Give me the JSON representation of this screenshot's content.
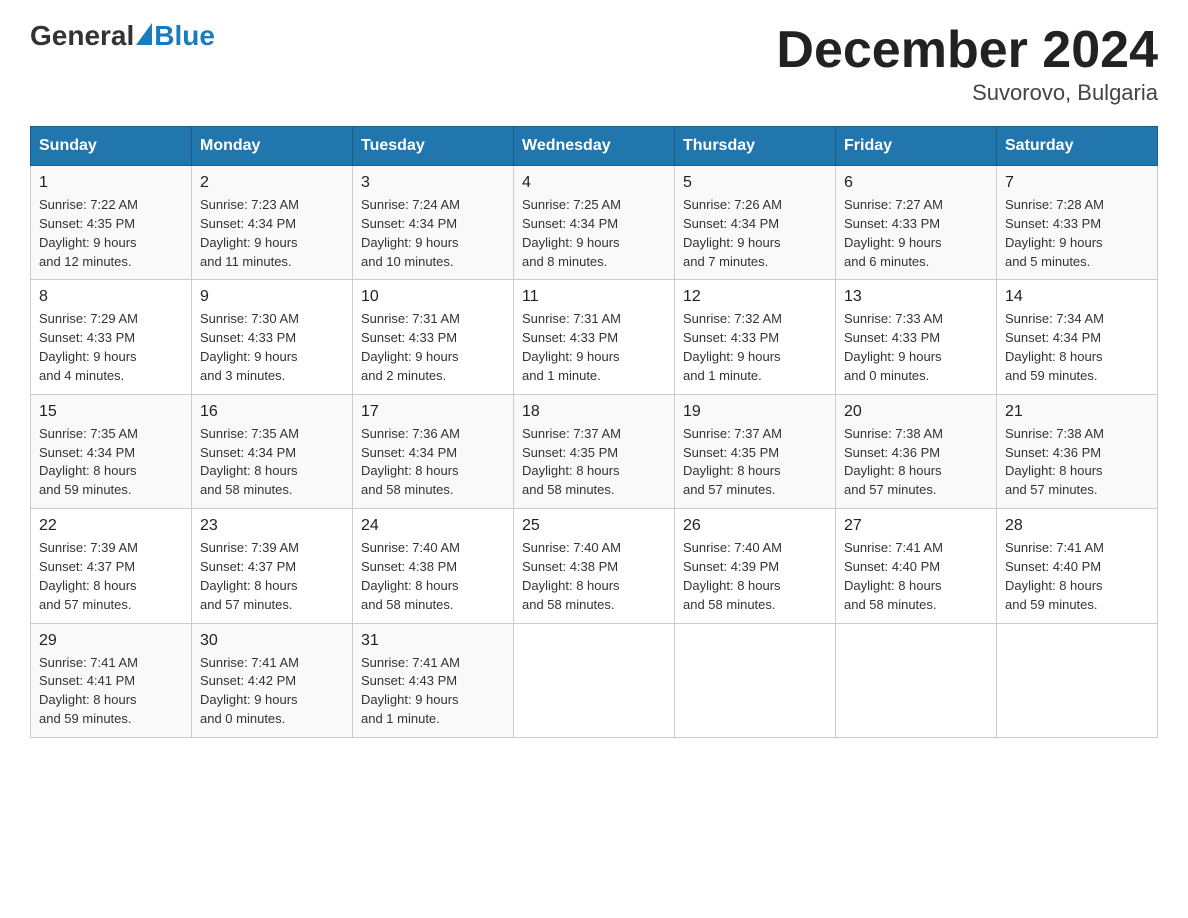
{
  "logo": {
    "general": "General",
    "blue": "Blue"
  },
  "title": "December 2024",
  "subtitle": "Suvorovo, Bulgaria",
  "days_of_week": [
    "Sunday",
    "Monday",
    "Tuesday",
    "Wednesday",
    "Thursday",
    "Friday",
    "Saturday"
  ],
  "weeks": [
    [
      {
        "day": "1",
        "info": "Sunrise: 7:22 AM\nSunset: 4:35 PM\nDaylight: 9 hours\nand 12 minutes."
      },
      {
        "day": "2",
        "info": "Sunrise: 7:23 AM\nSunset: 4:34 PM\nDaylight: 9 hours\nand 11 minutes."
      },
      {
        "day": "3",
        "info": "Sunrise: 7:24 AM\nSunset: 4:34 PM\nDaylight: 9 hours\nand 10 minutes."
      },
      {
        "day": "4",
        "info": "Sunrise: 7:25 AM\nSunset: 4:34 PM\nDaylight: 9 hours\nand 8 minutes."
      },
      {
        "day": "5",
        "info": "Sunrise: 7:26 AM\nSunset: 4:34 PM\nDaylight: 9 hours\nand 7 minutes."
      },
      {
        "day": "6",
        "info": "Sunrise: 7:27 AM\nSunset: 4:33 PM\nDaylight: 9 hours\nand 6 minutes."
      },
      {
        "day": "7",
        "info": "Sunrise: 7:28 AM\nSunset: 4:33 PM\nDaylight: 9 hours\nand 5 minutes."
      }
    ],
    [
      {
        "day": "8",
        "info": "Sunrise: 7:29 AM\nSunset: 4:33 PM\nDaylight: 9 hours\nand 4 minutes."
      },
      {
        "day": "9",
        "info": "Sunrise: 7:30 AM\nSunset: 4:33 PM\nDaylight: 9 hours\nand 3 minutes."
      },
      {
        "day": "10",
        "info": "Sunrise: 7:31 AM\nSunset: 4:33 PM\nDaylight: 9 hours\nand 2 minutes."
      },
      {
        "day": "11",
        "info": "Sunrise: 7:31 AM\nSunset: 4:33 PM\nDaylight: 9 hours\nand 1 minute."
      },
      {
        "day": "12",
        "info": "Sunrise: 7:32 AM\nSunset: 4:33 PM\nDaylight: 9 hours\nand 1 minute."
      },
      {
        "day": "13",
        "info": "Sunrise: 7:33 AM\nSunset: 4:33 PM\nDaylight: 9 hours\nand 0 minutes."
      },
      {
        "day": "14",
        "info": "Sunrise: 7:34 AM\nSunset: 4:34 PM\nDaylight: 8 hours\nand 59 minutes."
      }
    ],
    [
      {
        "day": "15",
        "info": "Sunrise: 7:35 AM\nSunset: 4:34 PM\nDaylight: 8 hours\nand 59 minutes."
      },
      {
        "day": "16",
        "info": "Sunrise: 7:35 AM\nSunset: 4:34 PM\nDaylight: 8 hours\nand 58 minutes."
      },
      {
        "day": "17",
        "info": "Sunrise: 7:36 AM\nSunset: 4:34 PM\nDaylight: 8 hours\nand 58 minutes."
      },
      {
        "day": "18",
        "info": "Sunrise: 7:37 AM\nSunset: 4:35 PM\nDaylight: 8 hours\nand 58 minutes."
      },
      {
        "day": "19",
        "info": "Sunrise: 7:37 AM\nSunset: 4:35 PM\nDaylight: 8 hours\nand 57 minutes."
      },
      {
        "day": "20",
        "info": "Sunrise: 7:38 AM\nSunset: 4:36 PM\nDaylight: 8 hours\nand 57 minutes."
      },
      {
        "day": "21",
        "info": "Sunrise: 7:38 AM\nSunset: 4:36 PM\nDaylight: 8 hours\nand 57 minutes."
      }
    ],
    [
      {
        "day": "22",
        "info": "Sunrise: 7:39 AM\nSunset: 4:37 PM\nDaylight: 8 hours\nand 57 minutes."
      },
      {
        "day": "23",
        "info": "Sunrise: 7:39 AM\nSunset: 4:37 PM\nDaylight: 8 hours\nand 57 minutes."
      },
      {
        "day": "24",
        "info": "Sunrise: 7:40 AM\nSunset: 4:38 PM\nDaylight: 8 hours\nand 58 minutes."
      },
      {
        "day": "25",
        "info": "Sunrise: 7:40 AM\nSunset: 4:38 PM\nDaylight: 8 hours\nand 58 minutes."
      },
      {
        "day": "26",
        "info": "Sunrise: 7:40 AM\nSunset: 4:39 PM\nDaylight: 8 hours\nand 58 minutes."
      },
      {
        "day": "27",
        "info": "Sunrise: 7:41 AM\nSunset: 4:40 PM\nDaylight: 8 hours\nand 58 minutes."
      },
      {
        "day": "28",
        "info": "Sunrise: 7:41 AM\nSunset: 4:40 PM\nDaylight: 8 hours\nand 59 minutes."
      }
    ],
    [
      {
        "day": "29",
        "info": "Sunrise: 7:41 AM\nSunset: 4:41 PM\nDaylight: 8 hours\nand 59 minutes."
      },
      {
        "day": "30",
        "info": "Sunrise: 7:41 AM\nSunset: 4:42 PM\nDaylight: 9 hours\nand 0 minutes."
      },
      {
        "day": "31",
        "info": "Sunrise: 7:41 AM\nSunset: 4:43 PM\nDaylight: 9 hours\nand 1 minute."
      },
      {
        "day": "",
        "info": ""
      },
      {
        "day": "",
        "info": ""
      },
      {
        "day": "",
        "info": ""
      },
      {
        "day": "",
        "info": ""
      }
    ]
  ]
}
